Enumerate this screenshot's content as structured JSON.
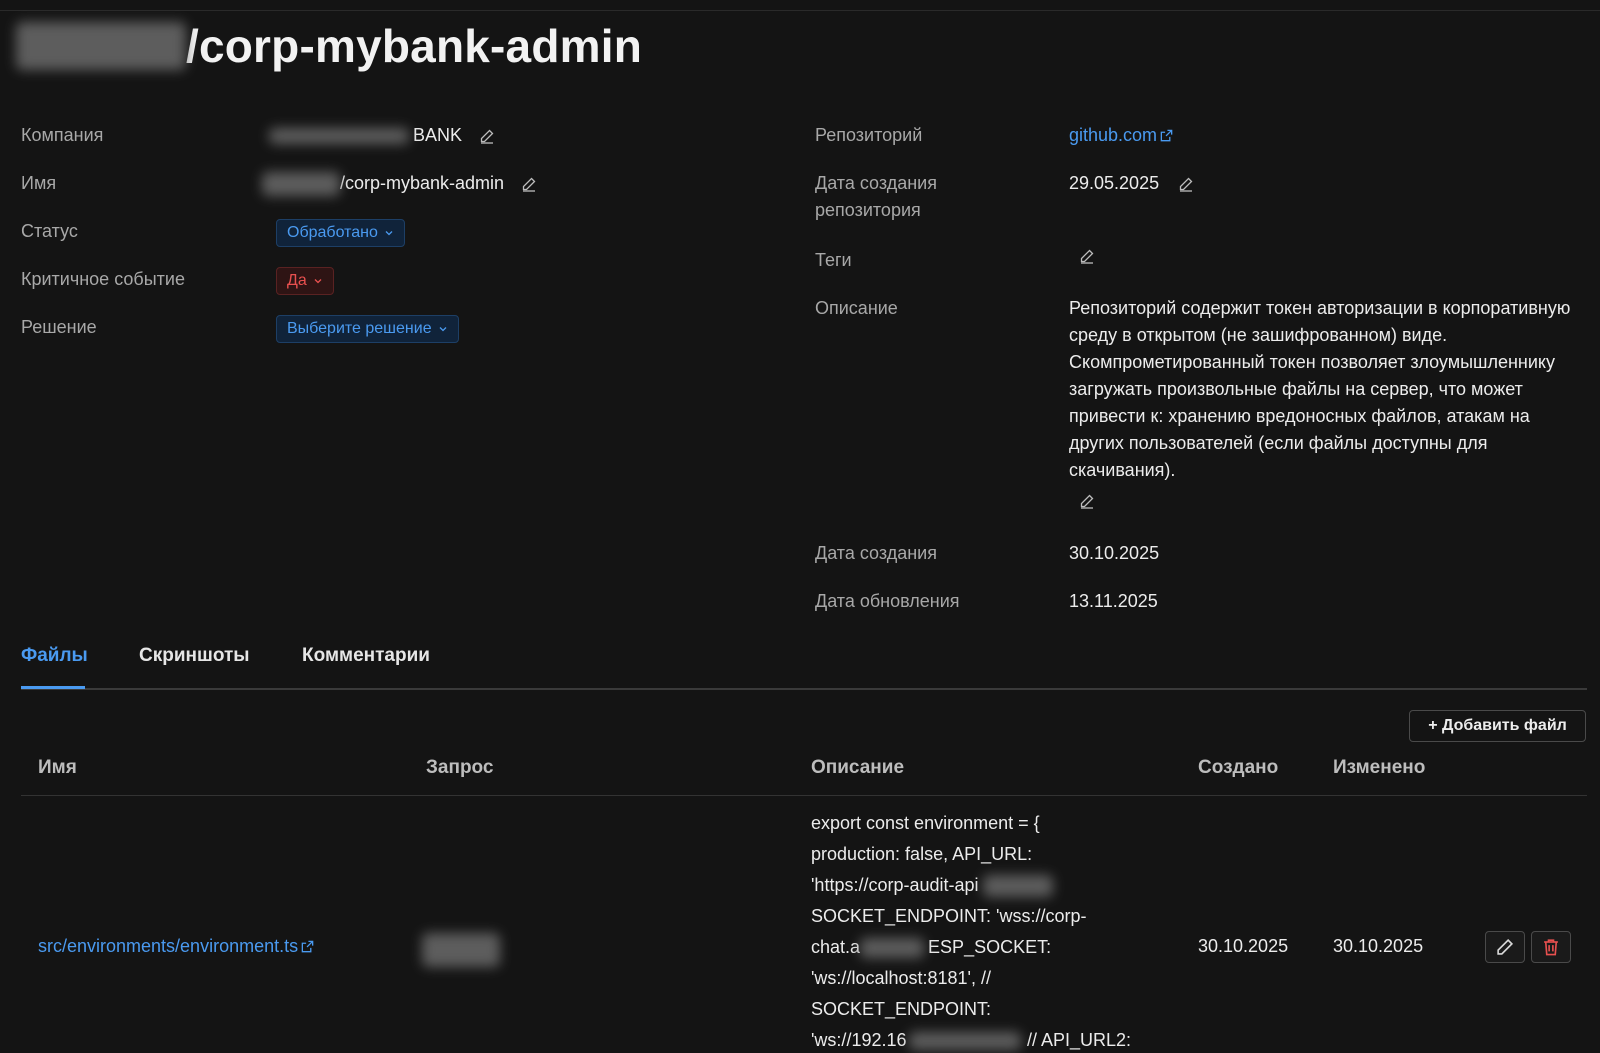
{
  "header": {
    "title": "/corp-mybank-admin"
  },
  "left_fields": {
    "company": {
      "label": "Компания",
      "value": "BANK"
    },
    "name": {
      "label": "Имя",
      "value": "/corp-mybank-admin"
    },
    "status": {
      "label": "Статус",
      "value": "Обработано"
    },
    "critical": {
      "label": "Критичное событие",
      "value": "Да"
    },
    "decision": {
      "label": "Решение",
      "value": "Выберите решение"
    }
  },
  "right_fields": {
    "repository": {
      "label": "Репозиторий",
      "value": "github.com"
    },
    "repo_created": {
      "label_line1": "Дата создания",
      "label_line2": "репозитория",
      "value": "29.05.2025"
    },
    "tags": {
      "label": "Теги"
    },
    "description": {
      "label": "Описание",
      "value": "Репозиторий содержит токен авторизации в корпоративную среду в открытом (не зашифрованном) виде. Скомпрометированный токен позволяет злоумышленнику загружать произвольные файлы на сервер, что может привести к: хранению вредоносных файлов, атакам на других пользователей (если файлы доступны для скачивания)."
    },
    "created": {
      "label": "Дата создания",
      "value": "30.10.2025"
    },
    "updated": {
      "label": "Дата обновления",
      "value": "13.11.2025"
    }
  },
  "tabs": [
    {
      "label": "Файлы",
      "active": true
    },
    {
      "label": "Скриншоты",
      "active": false
    },
    {
      "label": "Комментарии",
      "active": false
    }
  ],
  "files": {
    "add_button": "+ Добавить файл",
    "columns": [
      "Имя",
      "Запрос",
      "Описание",
      "Создано",
      "Изменено"
    ],
    "rows": [
      {
        "name": "src/environments/environment.ts",
        "description_lines": [
          "export const environment = {",
          "production: false, API_URL:",
          "'https://corp-audit-api",
          "SOCKET_ENDPOINT: 'wss://corp-",
          "chat.a",
          "ESP_SOCKET:",
          "'ws://localhost:8181', //",
          "SOCKET_ENDPOINT:",
          "'ws://192.16",
          "// API_URL2:"
        ],
        "created": "30.10.2025",
        "modified": "30.10.2025"
      }
    ]
  },
  "icons": {
    "edit": "pencil-icon",
    "external": "external-link-icon",
    "chevron": "chevron-down-icon",
    "delete": "trash-icon"
  },
  "colors": {
    "background": "#141414",
    "accent": "#4a9af0",
    "danger": "#e8504f"
  }
}
